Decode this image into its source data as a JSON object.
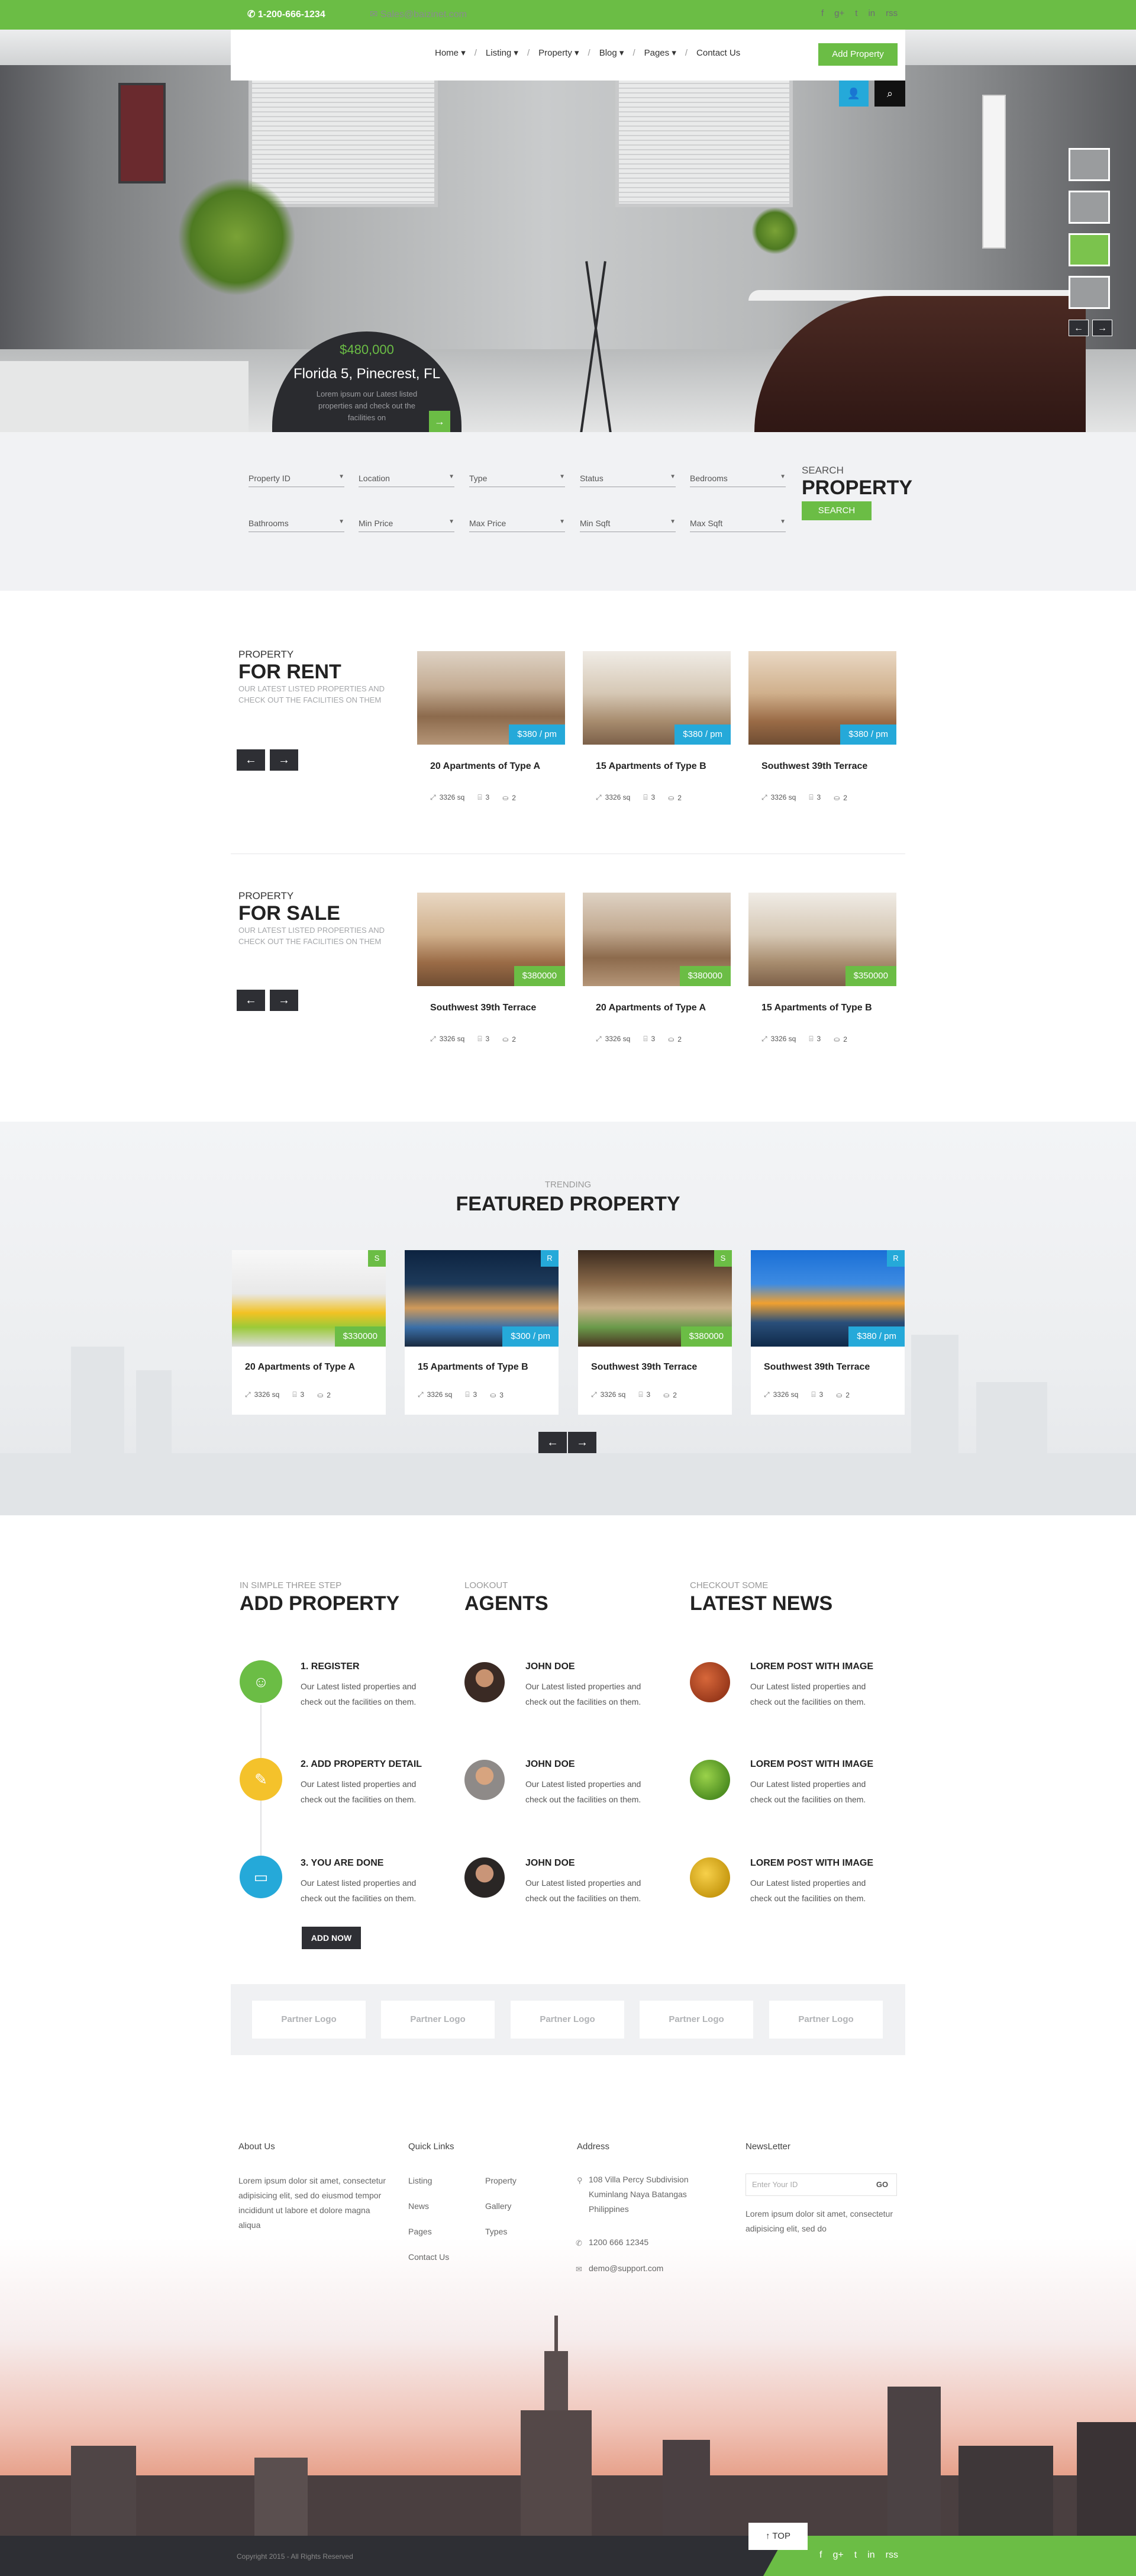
{
  "topbar": {
    "phone": "1-200-666-1234",
    "email": "Sales@baizinet.com",
    "socials": [
      "f",
      "g+",
      "t",
      "in",
      "rss"
    ]
  },
  "nav": {
    "items": [
      "Home",
      "Listing",
      "Property",
      "Blog",
      "Pages",
      "Contact Us"
    ],
    "add_property": "Add Property"
  },
  "hero": {
    "price": "$480,000",
    "title": "Florida 5, Pinecrest, FL",
    "desc": "Lorem ipsum our Latest listed properties and check out the facilities on"
  },
  "search": {
    "row1": [
      "Property ID",
      "Location",
      "Type",
      "Status",
      "Bedrooms"
    ],
    "row2": [
      "Bathrooms",
      "Min Price",
      "Max Price",
      "Min Sqft",
      "Max Sqft"
    ],
    "label": "SEARCH",
    "title": "PROPERTY",
    "button": "SEARCH"
  },
  "rent": {
    "label": "PROPERTY",
    "title": "FOR RENT",
    "desc": "OUR LATEST LISTED PROPERTIES AND CHECK OUT THE FACILITIES ON THEM",
    "cards": [
      {
        "title": "20 Apartments of Type A",
        "price": "$380 / pm",
        "sqft": "3326 sq",
        "beds": "3",
        "baths": "2"
      },
      {
        "title": "15 Apartments of Type B",
        "price": "$380 / pm",
        "sqft": "3326 sq",
        "beds": "3",
        "baths": "2"
      },
      {
        "title": "Southwest 39th Terrace",
        "price": "$380 / pm",
        "sqft": "3326 sq",
        "beds": "3",
        "baths": "2"
      }
    ]
  },
  "sale": {
    "label": "PROPERTY",
    "title": "FOR SALE",
    "desc": "OUR LATEST LISTED PROPERTIES AND CHECK OUT THE FACILITIES ON THEM",
    "cards": [
      {
        "title": "Southwest 39th Terrace",
        "price": "$380000",
        "sqft": "3326 sq",
        "beds": "3",
        "baths": "2"
      },
      {
        "title": "20 Apartments of Type A",
        "price": "$380000",
        "sqft": "3326 sq",
        "beds": "3",
        "baths": "2"
      },
      {
        "title": "15 Apartments of Type B",
        "price": "$350000",
        "sqft": "3326 sq",
        "beds": "3",
        "baths": "2"
      }
    ]
  },
  "featured": {
    "sub": "TRENDING",
    "title": "FEATURED PROPERTY",
    "cards": [
      {
        "title": "20 Apartments of Type A",
        "price": "$330000",
        "tag": "S",
        "sqft": "3326 sq",
        "beds": "3",
        "baths": "2"
      },
      {
        "title": "15 Apartments of Type B",
        "price": "$300 / pm",
        "tag": "R",
        "sqft": "3326 sq",
        "beds": "3",
        "baths": "3"
      },
      {
        "title": "Southwest 39th Terrace",
        "price": "$380000",
        "tag": "S",
        "sqft": "3326 sq",
        "beds": "3",
        "baths": "2"
      },
      {
        "title": "Southwest 39th Terrace",
        "price": "$380 / pm",
        "tag": "R",
        "sqft": "3326 sq",
        "beds": "3",
        "baths": "2"
      }
    ]
  },
  "add_property": {
    "sub": "IN SIMPLE THREE STEP",
    "title": "ADD PROPERTY",
    "steps": [
      {
        "title": "1. REGISTER",
        "desc": "Our Latest listed properties and check out the facilities on them."
      },
      {
        "title": "2. ADD PROPERTY DETAIL",
        "desc": "Our Latest listed properties and check out the facilities on them."
      },
      {
        "title": "3. YOU ARE DONE",
        "desc": "Our Latest listed properties and check out the facilities on them."
      }
    ],
    "button": "ADD NOW"
  },
  "agents": {
    "sub": "LOOKOUT",
    "title": "AGENTS",
    "items": [
      {
        "name": "JOHN DOE",
        "desc": "Our Latest listed properties and check out the facilities on them."
      },
      {
        "name": "JOHN DOE",
        "desc": "Our Latest listed properties and check out the facilities on them."
      },
      {
        "name": "JOHN DOE",
        "desc": "Our Latest listed properties and check out the facilities on them."
      }
    ]
  },
  "news": {
    "sub": "CHECKOUT SOME",
    "title": "LATEST NEWS",
    "items": [
      {
        "title": "LOREM POST WITH IMAGE",
        "desc": "Our Latest listed properties and check out the facilities on them."
      },
      {
        "title": "LOREM POST WITH IMAGE",
        "desc": "Our Latest listed properties and check out the facilities on them."
      },
      {
        "title": "LOREM POST WITH IMAGE",
        "desc": "Our Latest listed properties and check out the facilities on them."
      }
    ]
  },
  "partners": [
    "Partner Logo",
    "Partner Logo",
    "Partner Logo",
    "Partner Logo",
    "Partner Logo"
  ],
  "footer": {
    "about_title": "About Us",
    "about_text": "Lorem ipsum dolor sit amet, consectetur adipisicing elit, sed do eiusmod tempor incididunt ut labore et dolore magna aliqua",
    "links_title": "Quick Links",
    "links_col1": [
      "Listing",
      "News",
      "Pages",
      "Contact Us"
    ],
    "links_col2": [
      "Property",
      "Gallery",
      "Types"
    ],
    "address_title": "Address",
    "address": "108 Villa Percy Subdivision Kuminlang Naya Batangas Philippines",
    "phone": "1200 666 12345",
    "email": "demo@support.com",
    "newsletter_title": "NewsLetter",
    "newsletter_placeholder": "Enter Your ID",
    "newsletter_go": "GO",
    "newsletter_text": "Lorem ipsum dolor sit amet, consectetur adipisicing elit, sed do",
    "copyright": "Copyright 2015 - All Rights Reserved",
    "top": "TOP"
  }
}
